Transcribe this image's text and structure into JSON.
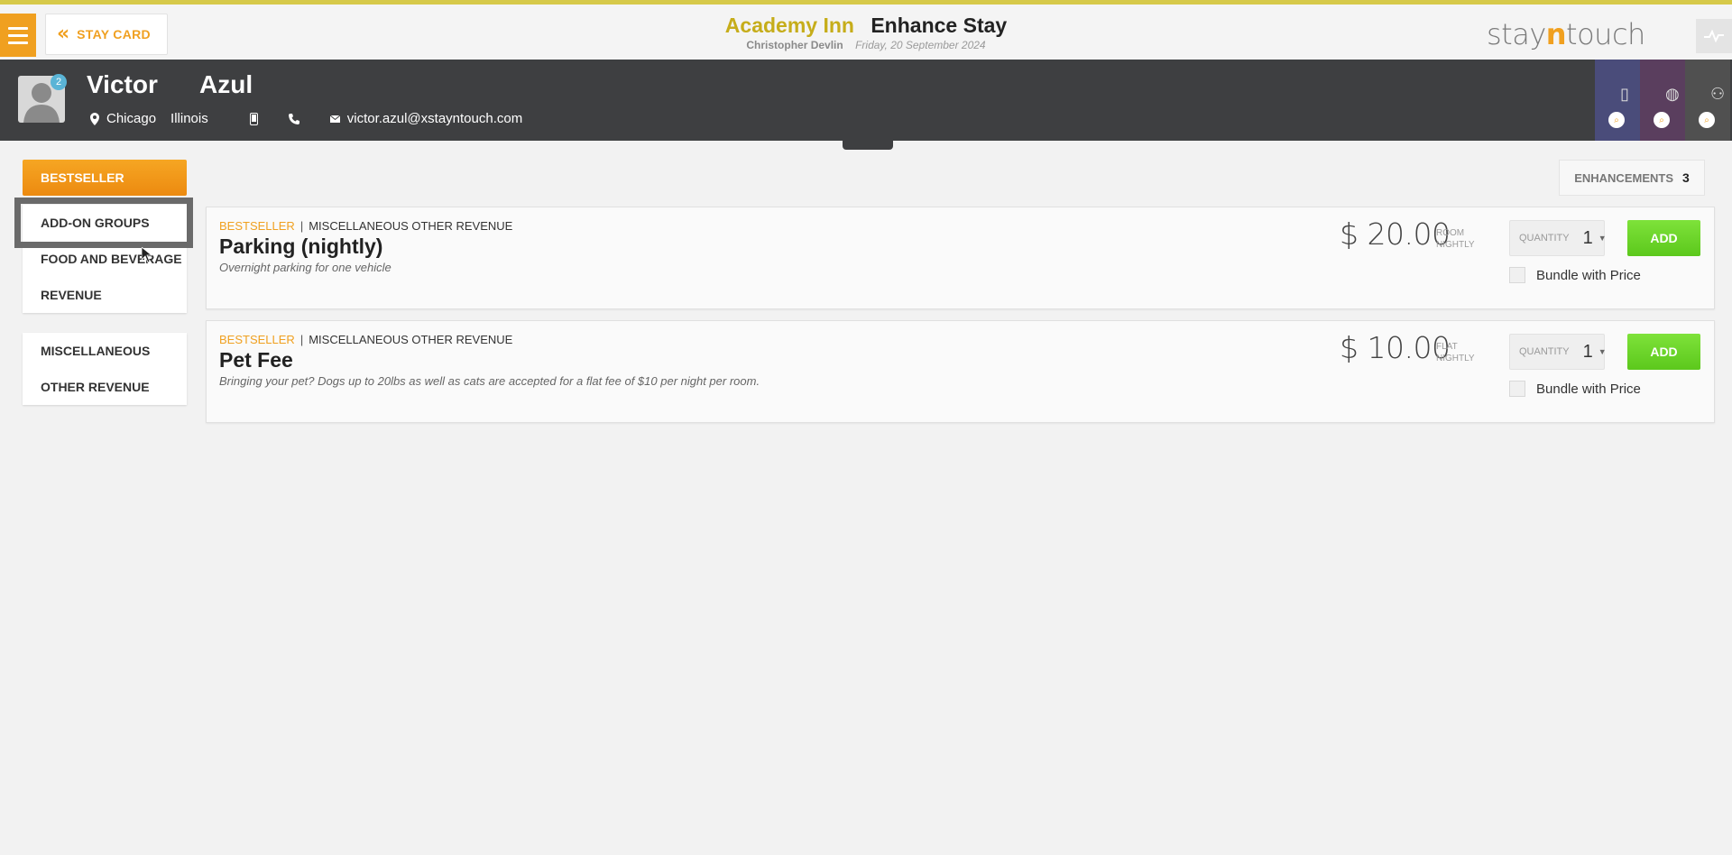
{
  "topbar": {
    "back_label": "STAY CARD",
    "hotel_name": "Academy Inn",
    "page_title": "Enhance Stay",
    "user_name": "Christopher Devlin",
    "date": "Friday, 20 September 2024",
    "logo_pre": "stay",
    "logo_n": "n",
    "logo_post": "touch"
  },
  "guest": {
    "first_name": "Victor",
    "last_name": "Azul",
    "badge_count": "2",
    "city": "Chicago",
    "state": "Illinois",
    "email": "victor.azul@xstayntouch.com"
  },
  "side_tiles": [
    {
      "color": "#4a4c7a",
      "icon": "building-icon"
    },
    {
      "color": "#5a3e5e",
      "icon": "globe-icon"
    },
    {
      "color": "#505050",
      "icon": "group-icon"
    }
  ],
  "nav": {
    "bestseller": "BESTSELLER",
    "group1": [
      "ADD-ON GROUPS",
      "FOOD AND BEVERAGE",
      "REVENUE"
    ],
    "group2": [
      "MISCELLANEOUS",
      "OTHER REVENUE"
    ]
  },
  "enhancements": {
    "label": "ENHANCEMENTS",
    "count": "3"
  },
  "items": [
    {
      "tag": "BESTSELLER",
      "category": "MISCELLANEOUS OTHER REVENUE",
      "name": "Parking (nightly)",
      "description": "Overnight parking for one vehicle",
      "price": "$ 20.00",
      "unit_line1": "ROOM",
      "unit_line2": "NIGHTLY",
      "qty_label": "QUANTITY",
      "qty_value": "1",
      "add_label": "ADD",
      "bundle_label": "Bundle with Price"
    },
    {
      "tag": "BESTSELLER",
      "category": "MISCELLANEOUS OTHER REVENUE",
      "name": "Pet Fee",
      "description": "Bringing your pet? Dogs up to 20lbs as well as cats are accepted for a flat fee of $10 per night per room.",
      "price": "$ 10.00",
      "unit_line1": "FLAT",
      "unit_line2": "NIGHTLY",
      "qty_label": "QUANTITY",
      "qty_value": "1",
      "add_label": "ADD",
      "bundle_label": "Bundle with Price"
    }
  ],
  "colors": {
    "accent": "#f0a020",
    "hotel_name": "#c6ad1a",
    "add_button": "#6ad62a",
    "guest_bar": "#3e3f41"
  }
}
